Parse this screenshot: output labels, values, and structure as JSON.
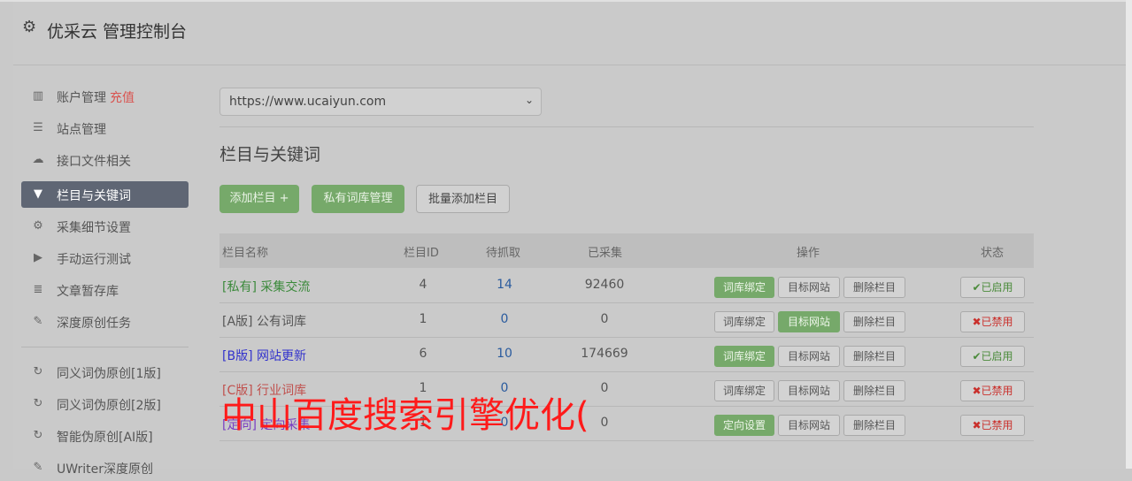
{
  "header": {
    "title": "优采云 管理控制台",
    "icon": "gear-icon"
  },
  "sidebar": {
    "items": [
      {
        "label": "账户管理",
        "extra": "充值",
        "icon": "bar-chart-icon"
      },
      {
        "label": "站点管理",
        "icon": "server-icon"
      },
      {
        "label": "接口文件相关",
        "icon": "cloud-upload-icon"
      },
      {
        "label": "栏目与关键词",
        "icon": "filter-icon",
        "active": true
      },
      {
        "label": "采集细节设置",
        "icon": "cogs-icon"
      },
      {
        "label": "手动运行测试",
        "icon": "play-circle-icon"
      },
      {
        "label": "文章暂存库",
        "icon": "database-icon"
      },
      {
        "label": "深度原创任务",
        "icon": "edit-icon"
      },
      {
        "label": "同义词伪原创[1版]",
        "icon": "refresh-icon"
      },
      {
        "label": "同义词伪原创[2版]",
        "icon": "refresh-icon"
      },
      {
        "label": "智能伪原创[AI版]",
        "icon": "refresh-icon"
      },
      {
        "label": "UWriter深度原创",
        "icon": "edit-icon"
      }
    ]
  },
  "main": {
    "site_select": "https://www.ucaiyun.com",
    "section_title": "栏目与关键词",
    "buttons": {
      "add": "添加栏目 +",
      "private_lib": "私有词库管理",
      "batch_add": "批量添加栏目"
    },
    "table": {
      "headers": [
        "栏目名称",
        "栏目ID",
        "待抓取",
        "已采集",
        "操作",
        "状态"
      ],
      "rows": [
        {
          "prefix": "[私有]",
          "name": "采集交流",
          "id": "4",
          "pending": "14",
          "collected": "92460",
          "op1": "词库绑定",
          "op2": "目标网站",
          "op3": "删除栏目",
          "status": "✔已启用"
        },
        {
          "prefix": "[A版]",
          "name": "公有词库",
          "id": "1",
          "pending": "0",
          "collected": "0",
          "op1": "词库绑定",
          "op2": "目标网站",
          "op3": "删除栏目",
          "status": "✖已禁用"
        },
        {
          "prefix": "[B版]",
          "name": "网站更新",
          "id": "6",
          "pending": "10",
          "collected": "174669",
          "op1": "词库绑定",
          "op2": "目标网站",
          "op3": "删除栏目",
          "status": "✔已启用"
        },
        {
          "prefix": "[C版]",
          "name": "行业词库",
          "id": "1",
          "pending": "0",
          "collected": "0",
          "op1": "词库绑定",
          "op2": "目标网站",
          "op3": "删除栏目",
          "status": "✖已禁用"
        },
        {
          "prefix": "[定向]",
          "name": "定向采集",
          "id": "1",
          "pending": "0",
          "collected": "0",
          "op1": "定向设置",
          "op2": "目标网站",
          "op3": "删除栏目",
          "status": "✖已禁用"
        }
      ]
    }
  },
  "watermark": "中山百度搜索引擎优化(",
  "colors": {
    "green": "#76a96a",
    "active_nav": "#5f6674",
    "red": "#ff1a1a",
    "link_blue": "#2a5b9e"
  }
}
